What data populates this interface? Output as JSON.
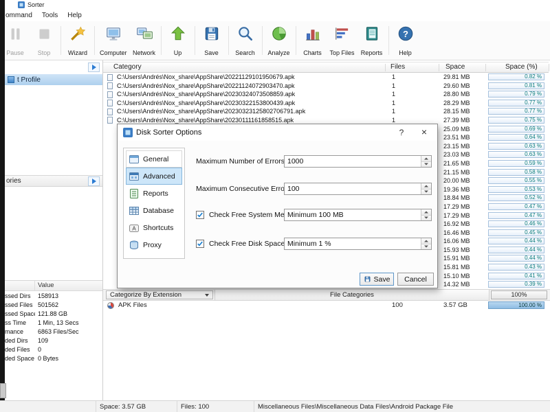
{
  "window": {
    "title": "Sorter"
  },
  "menu": {
    "items": [
      "ommand",
      "Tools",
      "Help"
    ]
  },
  "toolbar": {
    "buttons": [
      {
        "name": "pause",
        "label": "Pause",
        "disabled": true
      },
      {
        "name": "stop",
        "label": "Stop",
        "disabled": true,
        "sep": true
      },
      {
        "name": "wizard",
        "label": "Wizard",
        "sep": true
      },
      {
        "name": "computer",
        "label": "Computer"
      },
      {
        "name": "network",
        "label": "Network",
        "sep": true
      },
      {
        "name": "up",
        "label": "Up",
        "sep": true
      },
      {
        "name": "save",
        "label": "Save",
        "sep": true
      },
      {
        "name": "search",
        "label": "Search",
        "sep": true
      },
      {
        "name": "analyze",
        "label": "Analyze",
        "sep": true
      },
      {
        "name": "charts",
        "label": "Charts"
      },
      {
        "name": "top-files",
        "label": "Top Files"
      },
      {
        "name": "reports",
        "label": "Reports",
        "sep": true
      },
      {
        "name": "help",
        "label": "Help"
      }
    ]
  },
  "left_panel": {
    "profile_item": "t Profile",
    "categories_header": "ories",
    "stats": {
      "value_header": "Value",
      "rows": [
        {
          "label": "ssed Dirs",
          "value": "158913"
        },
        {
          "label": "ssed Files",
          "value": "501562"
        },
        {
          "label": "ssed Space",
          "value": "121.88 GB"
        },
        {
          "label": "ss Time",
          "value": "1 Min, 13 Secs"
        },
        {
          "label": "mance",
          "value": "6863 Files/Sec"
        },
        {
          "label": "ded Dirs",
          "value": "109"
        },
        {
          "label": "ded Files",
          "value": "0"
        },
        {
          "label": "ded Space",
          "value": "0 Bytes"
        }
      ]
    }
  },
  "table": {
    "headers": {
      "category": "Category",
      "files": "Files",
      "space": "Space",
      "pct": "Space (%)"
    },
    "rows": [
      {
        "path": "C:\\Users\\Andrés\\Nox_share\\AppShare\\20221129101950679.apk",
        "files": "1",
        "space": "29.81 MB",
        "pct": "0.82 %"
      },
      {
        "path": "C:\\Users\\Andrés\\Nox_share\\AppShare\\20221124072903470.apk",
        "files": "1",
        "space": "29.60 MB",
        "pct": "0.81 %"
      },
      {
        "path": "C:\\Users\\Andrés\\Nox_share\\AppShare\\20230324073508859.apk",
        "files": "1",
        "space": "28.80 MB",
        "pct": "0.79 %"
      },
      {
        "path": "C:\\Users\\Andrés\\Nox_share\\AppShare\\20230322153800439.apk",
        "files": "1",
        "space": "28.29 MB",
        "pct": "0.77 %"
      },
      {
        "path": "C:\\Users\\Andrés\\Nox_share\\AppShare\\20230323125802706791.apk",
        "files": "1",
        "space": "28.15 MB",
        "pct": "0.77 %"
      },
      {
        "path": "C:\\Users\\Andrés\\Nox_share\\AppShare\\20230111161858515.apk",
        "files": "1",
        "space": "27.39 MB",
        "pct": "0.75 %"
      },
      {
        "path": "",
        "files": "",
        "space": "25.09 MB",
        "pct": "0.69 %"
      },
      {
        "path": "",
        "files": "",
        "space": "23.51 MB",
        "pct": "0.64 %"
      },
      {
        "path": "",
        "files": "",
        "space": "23.15 MB",
        "pct": "0.63 %"
      },
      {
        "path": "",
        "files": "",
        "space": "23.03 MB",
        "pct": "0.63 %"
      },
      {
        "path": "",
        "files": "",
        "space": "21.65 MB",
        "pct": "0.59 %"
      },
      {
        "path": "",
        "files": "",
        "space": "21.15 MB",
        "pct": "0.58 %"
      },
      {
        "path": "",
        "files": "",
        "space": "20.00 MB",
        "pct": "0.55 %"
      },
      {
        "path": "",
        "files": "",
        "space": "19.36 MB",
        "pct": "0.53 %"
      },
      {
        "path": "",
        "files": "",
        "space": "18.84 MB",
        "pct": "0.52 %"
      },
      {
        "path": "",
        "files": "",
        "space": "17.29 MB",
        "pct": "0.47 %"
      },
      {
        "path": "",
        "files": "",
        "space": "17.29 MB",
        "pct": "0.47 %"
      },
      {
        "path": "",
        "files": "",
        "space": "16.92 MB",
        "pct": "0.46 %"
      },
      {
        "path": "",
        "files": "",
        "space": "16.46 MB",
        "pct": "0.45 %"
      },
      {
        "path": "",
        "files": "",
        "space": "16.06 MB",
        "pct": "0.44 %"
      },
      {
        "path": "",
        "files": "",
        "space": "15.93 MB",
        "pct": "0.44 %"
      },
      {
        "path": "",
        "files": "",
        "space": "15.91 MB",
        "pct": "0.44 %"
      },
      {
        "path": "",
        "files": "",
        "space": "15.81 MB",
        "pct": "0.43 %"
      },
      {
        "path": "",
        "files": "",
        "space": "15.10 MB",
        "pct": "0.41 %"
      },
      {
        "path": "",
        "files": "",
        "space": "14.32 MB",
        "pct": "0.39 %"
      }
    ]
  },
  "dialog": {
    "title": "Disk Sorter Options",
    "help_label": "?",
    "close_label": "×",
    "tabs": [
      {
        "name": "general",
        "label": "General"
      },
      {
        "name": "advanced",
        "label": "Advanced",
        "selected": true
      },
      {
        "name": "reports",
        "label": "Reports"
      },
      {
        "name": "database",
        "label": "Database"
      },
      {
        "name": "shortcuts",
        "label": "Shortcuts"
      },
      {
        "name": "proxy",
        "label": "Proxy"
      }
    ],
    "fields": [
      {
        "name": "maximum-number-of-errors",
        "label": "Maximum Number of Errors:",
        "value": "1000",
        "checkbox": false
      },
      {
        "name": "maximum-consecutive-errors",
        "label": "Maximum Consecutive Errors:",
        "value": "100",
        "checkbox": false
      },
      {
        "name": "check-free-system-memory",
        "label": "Check Free System Memory:",
        "value": "Minimum 100 MB",
        "checkbox": true,
        "checked": true
      },
      {
        "name": "check-free-disk-space",
        "label": "Check Free Disk Space:",
        "value": "Minimum 1 %",
        "checkbox": true,
        "checked": true
      }
    ],
    "save_label": "Save",
    "cancel_label": "Cancel"
  },
  "bottom_panel": {
    "combo_label": "Categorize By Extension",
    "list_header": "File Categories",
    "pct_header": "100%",
    "rows": [
      {
        "name": "APK Files",
        "files": "100",
        "space": "3.57 GB",
        "pct": "100.00 %"
      }
    ]
  },
  "statusbar": {
    "space": "Space: 3.57 GB",
    "files": "Files: 100",
    "category_path": "Miscellaneous Files\\Miscellaneous Data Files\\Android Package File"
  }
}
